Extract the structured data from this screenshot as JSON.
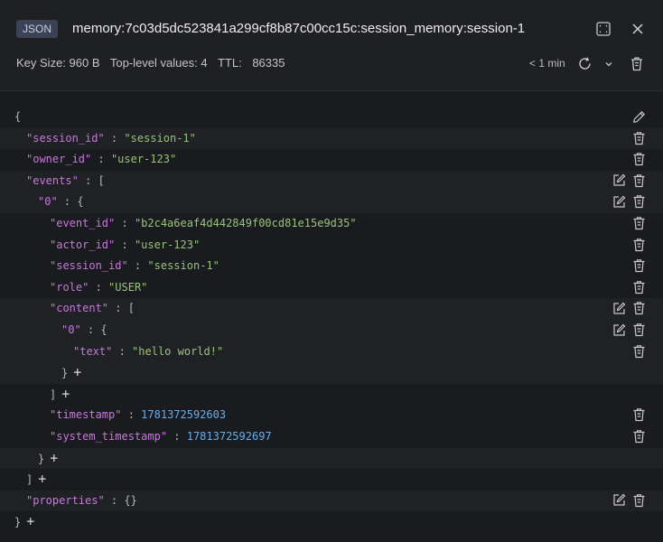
{
  "header": {
    "type_badge": "JSON",
    "key_name": "memory:7c03d5dc523841a299cf8b87c00cc15c:session_memory:session-1",
    "key_size": "Key Size: 960 B",
    "top_level_values": "Top-level values: 4",
    "ttl_label": "TTL:",
    "ttl_value": "86335",
    "refresh_label": "< 1 min",
    "icons": [
      "maximize-icon",
      "close-icon",
      "refresh-icon",
      "chevron-down-icon",
      "trash-icon"
    ]
  },
  "json_rows": [
    {
      "open": "{"
    },
    {
      "key": "\"session_id\"",
      "sep": " : ",
      "str": "\"session-1\""
    },
    {
      "key": "\"owner_id\"",
      "sep": " : ",
      "str": "\"user-123\""
    },
    {
      "key": "\"events\"",
      "sep": " : ",
      "open": "["
    },
    {
      "key": "\"0\"",
      "sep": " : ",
      "open": "{"
    },
    {
      "key": "\"event_id\"",
      "sep": " : ",
      "str": "\"b2c4a6eaf4d442849f00cd81e15e9d35\""
    },
    {
      "key": "\"actor_id\"",
      "sep": " : ",
      "str": "\"user-123\""
    },
    {
      "key": "\"session_id\"",
      "sep": " : ",
      "str": "\"session-1\""
    },
    {
      "key": "\"role\"",
      "sep": " : ",
      "str": "\"USER\""
    },
    {
      "key": "\"content\"",
      "sep": " : ",
      "open": "["
    },
    {
      "key": "\"0\"",
      "sep": " : ",
      "open": "{"
    },
    {
      "key": "\"text\"",
      "sep": " : ",
      "str": "\"hello world!\""
    },
    {
      "close": "}",
      "plus": "+"
    },
    {
      "close": "]",
      "plus": "+"
    },
    {
      "key": "\"timestamp\"",
      "sep": " : ",
      "num": "1781372592603"
    },
    {
      "key": "\"system_timestamp\"",
      "sep": " : ",
      "num": "1781372592697"
    },
    {
      "close": "}",
      "plus": "+"
    },
    {
      "close": "]",
      "plus": "+"
    },
    {
      "key": "\"properties\"",
      "sep": " : ",
      "open": "{}"
    },
    {
      "close": "}",
      "plus": "+"
    }
  ]
}
